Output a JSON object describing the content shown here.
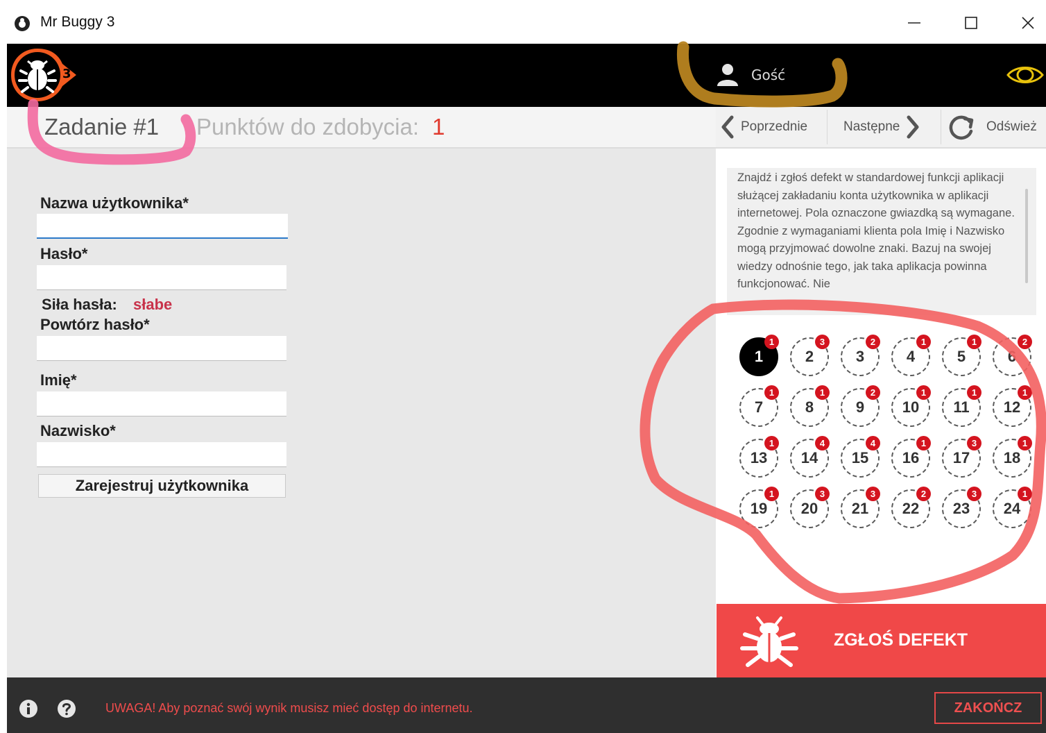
{
  "window": {
    "title": "Mr Buggy 3",
    "controls": {
      "minimize": "—",
      "maximize": "☐",
      "close": "✕"
    }
  },
  "header": {
    "logo_badge": "3",
    "user_label": "Gość",
    "user_icon": "user-icon",
    "view_icon": "eye-icon"
  },
  "task": {
    "title": "Zadanie #1",
    "points_label": "Punktów do zdobycia:",
    "points_value": "1"
  },
  "nav": {
    "prev_label": "Poprzednie",
    "next_label": "Następne",
    "refresh_label": "Odśwież"
  },
  "form": {
    "username_label": "Nazwa użytkownika*",
    "username_value": "",
    "password_label": "Hasło*",
    "password_value": "",
    "strength_label": "Siła hasła:",
    "strength_value": "słabe",
    "repeat_label": "Powtórz hasło*",
    "repeat_value": "",
    "firstname_label": "Imię*",
    "firstname_value": "",
    "lastname_label": "Nazwisko*",
    "lastname_value": "",
    "submit_label": "Zarejestruj użytkownika"
  },
  "description": "Znajdź i zgłoś defekt w standardowej funkcji aplikacji służącej zakładaniu konta użytkownika w aplikacji internetowej. Pola oznaczone gwiazdką są wymagane. Zgodnie z wymaganiami klienta pola Imię i Nazwisko mogą przyjmować dowolne znaki. Bazuj na swojej wiedzy odnośnie tego, jak taka aplikacja powinna funkcjonować. Nie",
  "levels": [
    {
      "number": "1",
      "badge": "1",
      "active": true
    },
    {
      "number": "2",
      "badge": "3"
    },
    {
      "number": "3",
      "badge": "2"
    },
    {
      "number": "4",
      "badge": "1"
    },
    {
      "number": "5",
      "badge": "1"
    },
    {
      "number": "6",
      "badge": "2"
    },
    {
      "number": "7",
      "badge": "1"
    },
    {
      "number": "8",
      "badge": "1"
    },
    {
      "number": "9",
      "badge": "2"
    },
    {
      "number": "10",
      "badge": "1"
    },
    {
      "number": "11",
      "badge": "1"
    },
    {
      "number": "12",
      "badge": "1"
    },
    {
      "number": "13",
      "badge": "1"
    },
    {
      "number": "14",
      "badge": "4"
    },
    {
      "number": "15",
      "badge": "4"
    },
    {
      "number": "16",
      "badge": "1"
    },
    {
      "number": "17",
      "badge": "3"
    },
    {
      "number": "18",
      "badge": "1"
    },
    {
      "number": "19",
      "badge": "1"
    },
    {
      "number": "20",
      "badge": "3"
    },
    {
      "number": "21",
      "badge": "3"
    },
    {
      "number": "22",
      "badge": "2"
    },
    {
      "number": "23",
      "badge": "3"
    },
    {
      "number": "24",
      "badge": "1"
    }
  ],
  "report": {
    "label": "ZGŁOŚ DEFEKT",
    "icon": "bug-icon"
  },
  "footer": {
    "warning": "UWAGA! Aby poznać swój wynik musisz mieć dostęp do internetu.",
    "finish_label": "ZAKOŃCZ",
    "info_icon": "info-icon",
    "help_icon": "help-icon"
  },
  "colors": {
    "header_bg": "#000000",
    "accent_red": "#f04848",
    "badge_red": "#d4141f",
    "strength_red": "#c8324a",
    "annotation_pink": "#f36aa0",
    "annotation_gold": "#b88420",
    "annotation_red": "#f36060"
  }
}
